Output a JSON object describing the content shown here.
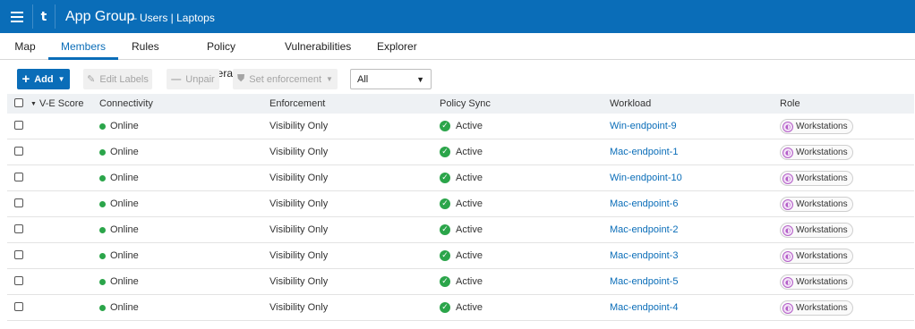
{
  "header": {
    "app_title": "App Group",
    "subtitle": "–  Users | Laptops",
    "logo": "t",
    "background_color": "#0a6db8"
  },
  "tabs": [
    {
      "label": "Map",
      "active": false
    },
    {
      "label": "Members",
      "active": true
    },
    {
      "label": "Rules",
      "active": false
    },
    {
      "label": "Policy Generator",
      "active": false
    },
    {
      "label": "Vulnerabilities",
      "active": false
    },
    {
      "label": "Explorer",
      "active": false
    }
  ],
  "toolbar": {
    "add_label": "Add",
    "edit_labels_label": "Edit Labels",
    "unpair_label": "Unpair",
    "set_enforcement_label": "Set enforcement",
    "filter_value": "All"
  },
  "table": {
    "columns": {
      "ve_score": "V-E Score",
      "connectivity": "Connectivity",
      "enforcement": "Enforcement",
      "policy_sync": "Policy Sync",
      "workload": "Workload",
      "role": "Role"
    },
    "rows": [
      {
        "connectivity": "Online",
        "enforcement": "Visibility Only",
        "policy_sync": "Active",
        "workload": "Win-endpoint-9",
        "role": "Workstations"
      },
      {
        "connectivity": "Online",
        "enforcement": "Visibility Only",
        "policy_sync": "Active",
        "workload": "Mac-endpoint-1",
        "role": "Workstations"
      },
      {
        "connectivity": "Online",
        "enforcement": "Visibility Only",
        "policy_sync": "Active",
        "workload": "Win-endpoint-10",
        "role": "Workstations"
      },
      {
        "connectivity": "Online",
        "enforcement": "Visibility Only",
        "policy_sync": "Active",
        "workload": "Mac-endpoint-6",
        "role": "Workstations"
      },
      {
        "connectivity": "Online",
        "enforcement": "Visibility Only",
        "policy_sync": "Active",
        "workload": "Mac-endpoint-2",
        "role": "Workstations"
      },
      {
        "connectivity": "Online",
        "enforcement": "Visibility Only",
        "policy_sync": "Active",
        "workload": "Mac-endpoint-3",
        "role": "Workstations"
      },
      {
        "connectivity": "Online",
        "enforcement": "Visibility Only",
        "policy_sync": "Active",
        "workload": "Mac-endpoint-5",
        "role": "Workstations"
      },
      {
        "connectivity": "Online",
        "enforcement": "Visibility Only",
        "policy_sync": "Active",
        "workload": "Mac-endpoint-4",
        "role": "Workstations"
      }
    ]
  },
  "colors": {
    "accent": "#0a6db8",
    "online": "#2ba54a",
    "role_badge": "#b45fc8"
  }
}
